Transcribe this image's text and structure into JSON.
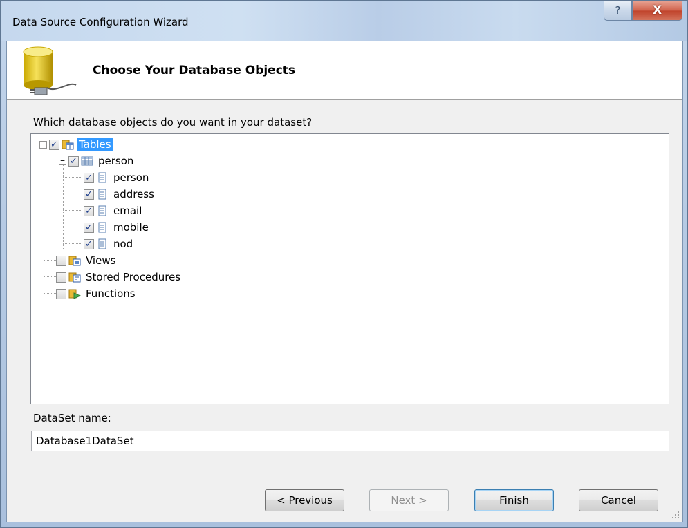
{
  "window": {
    "title": "Data Source Configuration Wizard",
    "help_glyph": "?",
    "close_glyph": "X"
  },
  "header": {
    "title": "Choose Your Database Objects",
    "icon": "database-plug-icon"
  },
  "body": {
    "question": "Which database objects do you want in your dataset?",
    "tree": {
      "tables": {
        "label": "Tables",
        "checked": true,
        "expanded": true,
        "selected": true
      },
      "person_table": {
        "label": "person",
        "checked": true,
        "expanded": true
      },
      "columns": [
        {
          "label": "person",
          "checked": true
        },
        {
          "label": "address",
          "checked": true
        },
        {
          "label": "email",
          "checked": true
        },
        {
          "label": "mobile",
          "checked": true
        },
        {
          "label": "nod",
          "checked": true
        }
      ],
      "views": {
        "label": "Views",
        "checked": false
      },
      "stored_procedures": {
        "label": "Stored Procedures",
        "checked": false
      },
      "functions": {
        "label": "Functions",
        "checked": false
      }
    },
    "dataset_label": "DataSet name:",
    "dataset_value": "Database1DataSet"
  },
  "buttons": {
    "previous": "< Previous",
    "next": "Next >",
    "finish": "Finish",
    "cancel": "Cancel"
  },
  "colors": {
    "selection": "#3399ff",
    "close_button": "#c0442c",
    "check_mark": "#1f3f8c"
  }
}
